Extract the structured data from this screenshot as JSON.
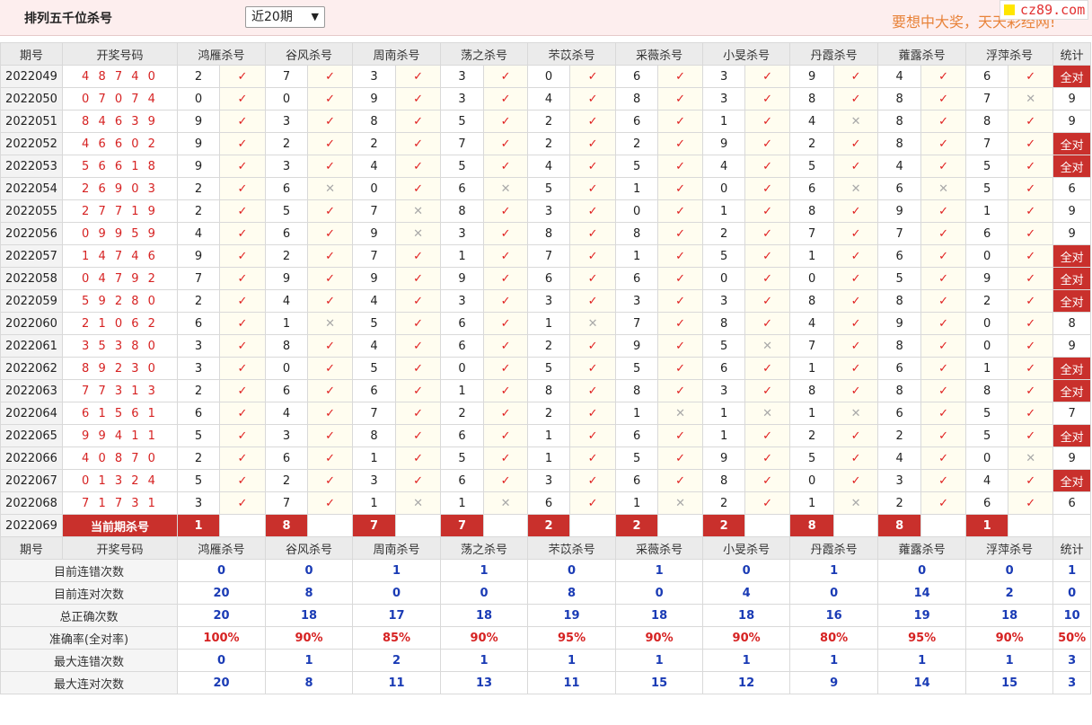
{
  "header": {
    "title": "排列五千位杀号",
    "period_selected": "近20期",
    "slogan": "要想中大奖，天天彩经网!",
    "logo_text": "cz89.com"
  },
  "columns": {
    "issue": "期号",
    "numbers": "开奖号码",
    "experts": [
      "鸿雁杀号",
      "谷风杀号",
      "周南杀号",
      "荡之杀号",
      "芣苡杀号",
      "采薇杀号",
      "小旻杀号",
      "丹霞杀号",
      "蕹露杀号",
      "浮萍杀号"
    ],
    "total": "统计"
  },
  "rows": [
    {
      "issue": "2022049",
      "numbers": "48740",
      "kills": [
        2,
        7,
        3,
        3,
        0,
        6,
        3,
        9,
        4,
        6
      ],
      "hits": [
        1,
        1,
        1,
        1,
        1,
        1,
        1,
        1,
        1,
        1
      ],
      "total": "全对"
    },
    {
      "issue": "2022050",
      "numbers": "07074",
      "kills": [
        0,
        0,
        9,
        3,
        4,
        8,
        3,
        8,
        8,
        7
      ],
      "hits": [
        1,
        1,
        1,
        1,
        1,
        1,
        1,
        1,
        1,
        0
      ],
      "total": "9"
    },
    {
      "issue": "2022051",
      "numbers": "84639",
      "kills": [
        9,
        3,
        8,
        5,
        2,
        6,
        1,
        4,
        8,
        8
      ],
      "hits": [
        1,
        1,
        1,
        1,
        1,
        1,
        1,
        0,
        1,
        1
      ],
      "total": "9"
    },
    {
      "issue": "2022052",
      "numbers": "46602",
      "kills": [
        9,
        2,
        2,
        7,
        2,
        2,
        9,
        2,
        8,
        7
      ],
      "hits": [
        1,
        1,
        1,
        1,
        1,
        1,
        1,
        1,
        1,
        1
      ],
      "total": "全对"
    },
    {
      "issue": "2022053",
      "numbers": "56618",
      "kills": [
        9,
        3,
        4,
        5,
        4,
        5,
        4,
        5,
        4,
        5
      ],
      "hits": [
        1,
        1,
        1,
        1,
        1,
        1,
        1,
        1,
        1,
        1
      ],
      "total": "全对"
    },
    {
      "issue": "2022054",
      "numbers": "26903",
      "kills": [
        2,
        6,
        0,
        6,
        5,
        1,
        0,
        6,
        6,
        5
      ],
      "hits": [
        1,
        0,
        1,
        0,
        1,
        1,
        1,
        0,
        0,
        1
      ],
      "total": "6"
    },
    {
      "issue": "2022055",
      "numbers": "27719",
      "kills": [
        2,
        5,
        7,
        8,
        3,
        0,
        1,
        8,
        9,
        1
      ],
      "hits": [
        1,
        1,
        0,
        1,
        1,
        1,
        1,
        1,
        1,
        1
      ],
      "total": "9"
    },
    {
      "issue": "2022056",
      "numbers": "09959",
      "kills": [
        4,
        6,
        9,
        3,
        8,
        8,
        2,
        7,
        7,
        6
      ],
      "hits": [
        1,
        1,
        0,
        1,
        1,
        1,
        1,
        1,
        1,
        1
      ],
      "total": "9"
    },
    {
      "issue": "2022057",
      "numbers": "14746",
      "kills": [
        9,
        2,
        7,
        1,
        7,
        1,
        5,
        1,
        6,
        0
      ],
      "hits": [
        1,
        1,
        1,
        1,
        1,
        1,
        1,
        1,
        1,
        1
      ],
      "total": "全对"
    },
    {
      "issue": "2022058",
      "numbers": "04792",
      "kills": [
        7,
        9,
        9,
        9,
        6,
        6,
        0,
        0,
        5,
        9
      ],
      "hits": [
        1,
        1,
        1,
        1,
        1,
        1,
        1,
        1,
        1,
        1
      ],
      "total": "全对"
    },
    {
      "issue": "2022059",
      "numbers": "59280",
      "kills": [
        2,
        4,
        4,
        3,
        3,
        3,
        3,
        8,
        8,
        2
      ],
      "hits": [
        1,
        1,
        1,
        1,
        1,
        1,
        1,
        1,
        1,
        1
      ],
      "total": "全对"
    },
    {
      "issue": "2022060",
      "numbers": "21062",
      "kills": [
        6,
        1,
        5,
        6,
        1,
        7,
        8,
        4,
        9,
        0
      ],
      "hits": [
        1,
        0,
        1,
        1,
        0,
        1,
        1,
        1,
        1,
        1
      ],
      "total": "8"
    },
    {
      "issue": "2022061",
      "numbers": "35380",
      "kills": [
        3,
        8,
        4,
        6,
        2,
        9,
        5,
        7,
        8,
        0
      ],
      "hits": [
        1,
        1,
        1,
        1,
        1,
        1,
        0,
        1,
        1,
        1
      ],
      "total": "9"
    },
    {
      "issue": "2022062",
      "numbers": "89230",
      "kills": [
        3,
        0,
        5,
        0,
        5,
        5,
        6,
        1,
        6,
        1
      ],
      "hits": [
        1,
        1,
        1,
        1,
        1,
        1,
        1,
        1,
        1,
        1
      ],
      "total": "全对"
    },
    {
      "issue": "2022063",
      "numbers": "77313",
      "kills": [
        2,
        6,
        6,
        1,
        8,
        8,
        3,
        8,
        8,
        8
      ],
      "hits": [
        1,
        1,
        1,
        1,
        1,
        1,
        1,
        1,
        1,
        1
      ],
      "total": "全对"
    },
    {
      "issue": "2022064",
      "numbers": "61561",
      "kills": [
        6,
        4,
        7,
        2,
        2,
        1,
        1,
        1,
        6,
        5
      ],
      "hits": [
        1,
        1,
        1,
        1,
        1,
        0,
        0,
        0,
        1,
        1
      ],
      "total": "7"
    },
    {
      "issue": "2022065",
      "numbers": "99411",
      "kills": [
        5,
        3,
        8,
        6,
        1,
        6,
        1,
        2,
        2,
        5
      ],
      "hits": [
        1,
        1,
        1,
        1,
        1,
        1,
        1,
        1,
        1,
        1
      ],
      "total": "全对"
    },
    {
      "issue": "2022066",
      "numbers": "40870",
      "kills": [
        2,
        6,
        1,
        5,
        1,
        5,
        9,
        5,
        4,
        0
      ],
      "hits": [
        1,
        1,
        1,
        1,
        1,
        1,
        1,
        1,
        1,
        0
      ],
      "total": "9"
    },
    {
      "issue": "2022067",
      "numbers": "01324",
      "kills": [
        5,
        2,
        3,
        6,
        3,
        6,
        8,
        0,
        3,
        4
      ],
      "hits": [
        1,
        1,
        1,
        1,
        1,
        1,
        1,
        1,
        1,
        1
      ],
      "total": "全对"
    },
    {
      "issue": "2022068",
      "numbers": "71731",
      "kills": [
        3,
        7,
        1,
        1,
        6,
        1,
        2,
        1,
        2,
        6
      ],
      "hits": [
        1,
        1,
        0,
        0,
        1,
        0,
        1,
        0,
        1,
        1
      ],
      "total": "6"
    }
  ],
  "current": {
    "issue": "2022069",
    "label": "当前期杀号",
    "kills": [
      1,
      8,
      7,
      7,
      2,
      2,
      2,
      8,
      8,
      1
    ]
  },
  "stats": [
    {
      "label": "目前连错次数",
      "values": [
        "0",
        "0",
        "1",
        "1",
        "0",
        "1",
        "0",
        "1",
        "0",
        "0"
      ],
      "total": "1",
      "color": "blue"
    },
    {
      "label": "目前连对次数",
      "values": [
        "20",
        "8",
        "0",
        "0",
        "8",
        "0",
        "4",
        "0",
        "14",
        "2"
      ],
      "total": "0",
      "color": "blue"
    },
    {
      "label": "总正确次数",
      "values": [
        "20",
        "18",
        "17",
        "18",
        "19",
        "18",
        "18",
        "16",
        "19",
        "18"
      ],
      "total": "10",
      "color": "blue"
    },
    {
      "label": "准确率(全对率)",
      "values": [
        "100%",
        "90%",
        "85%",
        "90%",
        "95%",
        "90%",
        "90%",
        "80%",
        "95%",
        "90%"
      ],
      "total": "50%",
      "color": "red"
    },
    {
      "label": "最大连错次数",
      "values": [
        "0",
        "1",
        "2",
        "1",
        "1",
        "1",
        "1",
        "1",
        "1",
        "1"
      ],
      "total": "3",
      "color": "blue"
    },
    {
      "label": "最大连对次数",
      "values": [
        "20",
        "8",
        "11",
        "13",
        "11",
        "15",
        "12",
        "9",
        "14",
        "15"
      ],
      "total": "3",
      "color": "blue"
    }
  ],
  "marks": {
    "hit": "✓",
    "miss": "✕"
  },
  "colors": {
    "accent_red": "#c9302c",
    "number_red": "#d62222",
    "stat_blue": "#1a3bb5",
    "slogan_orange": "#e8833a"
  }
}
